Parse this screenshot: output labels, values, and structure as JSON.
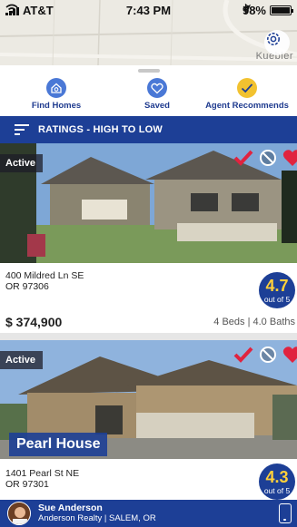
{
  "status_bar": {
    "carrier": "AT&T",
    "time": "7:43 PM",
    "battery": "98%"
  },
  "map": {
    "label": "Kuebler"
  },
  "tabs": [
    {
      "label": "Find Homes",
      "icon": "home-search-icon",
      "color": "#4a78d6"
    },
    {
      "label": "Saved",
      "icon": "heart-icon",
      "color": "#4a78d6"
    },
    {
      "label": "Agent Recommends",
      "icon": "checkmark-icon",
      "color": "#f2c230"
    }
  ],
  "sort": {
    "label": "RATINGS - HIGH TO LOW"
  },
  "listings": [
    {
      "status": "Active",
      "address_line1": "400 Mildred Ln SE",
      "address_line2": "OR 97306",
      "rating": "4.7",
      "rating_suffix": "out of 5",
      "price": "$ 374,900",
      "beds_baths": "4 Beds | 4.0 Baths"
    },
    {
      "status": "Active",
      "name": "Pearl House",
      "address_line1": "1401 Pearl St NE",
      "address_line2": "OR 97301",
      "rating": "4.3",
      "rating_suffix": "out of 5"
    }
  ],
  "agent": {
    "name": "Sue Anderson",
    "company": "Anderson Realty | SALEM, OR"
  },
  "colors": {
    "brand_blue": "#1d3f96",
    "rating_yellow": "#ffcf3a",
    "favorite_red": "#e0233f"
  }
}
